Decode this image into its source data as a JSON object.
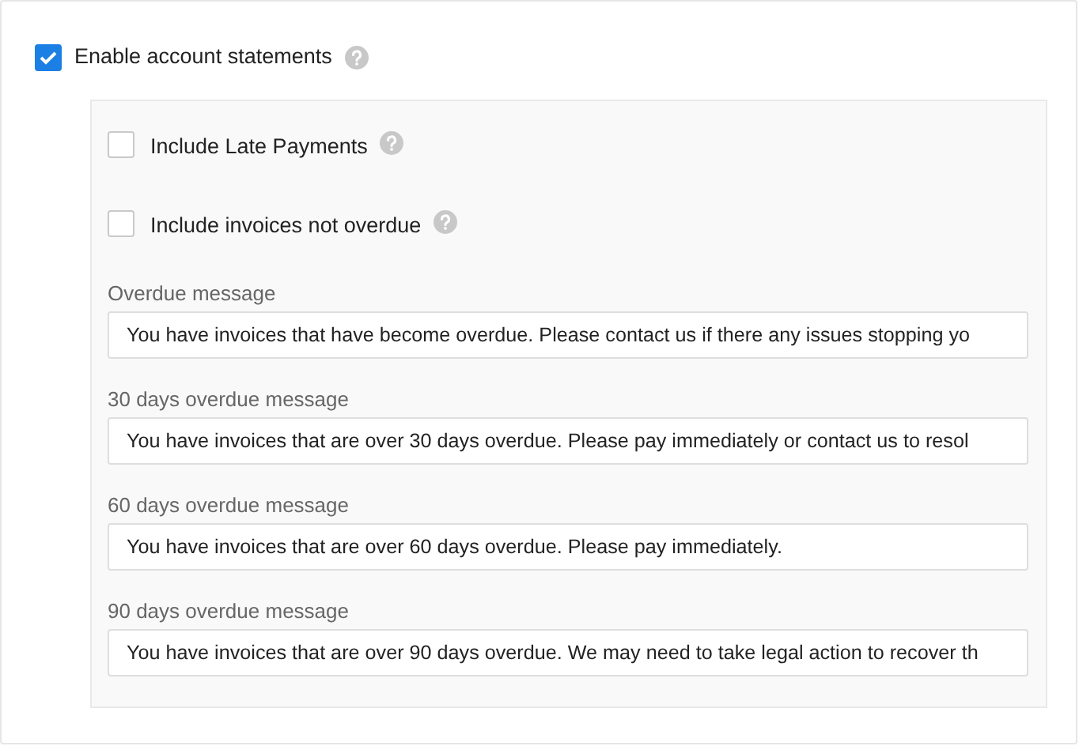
{
  "main_option": {
    "label": "Enable account statements",
    "checked": true
  },
  "options": [
    {
      "label": "Include Late Payments",
      "checked": false
    },
    {
      "label": "Include invoices not overdue",
      "checked": false
    }
  ],
  "messages": [
    {
      "label": "Overdue message",
      "value": "You have invoices that have become overdue. Please contact us if there any issues stopping yo"
    },
    {
      "label": "30 days overdue message",
      "value": "You have invoices that are over 30 days overdue. Please pay immediately or contact us to resol"
    },
    {
      "label": "60 days overdue message",
      "value": "You have invoices that are over 60 days overdue. Please pay immediately."
    },
    {
      "label": "90 days overdue message",
      "value": "You have invoices that are over 90 days overdue. We may need to take legal action to recover th"
    }
  ]
}
